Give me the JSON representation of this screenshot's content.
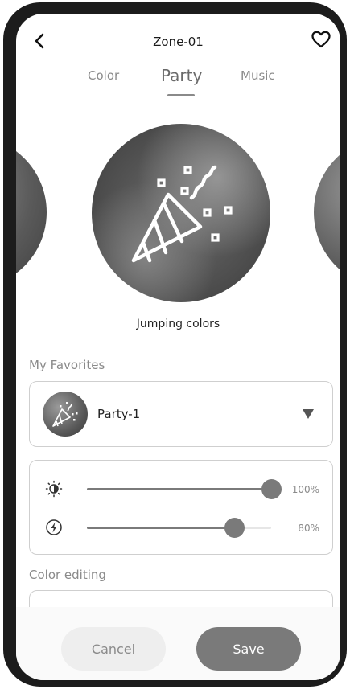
{
  "header": {
    "title": "Zone-01",
    "back_icon": "chevron-left-icon",
    "favorite_icon": "heart-outline-icon"
  },
  "tabs": [
    {
      "label": "Color",
      "active": false
    },
    {
      "label": "Party",
      "active": true
    },
    {
      "label": "Music",
      "active": false
    }
  ],
  "carousel": {
    "selected_effect": "Jumping colors",
    "icon": "party-popper-icon"
  },
  "favorites": {
    "label": "My Favorites",
    "selected": "Party-1",
    "thumb_icon": "party-popper-icon",
    "arrow_icon": "triangle-down-icon"
  },
  "sliders": [
    {
      "name": "brightness",
      "icon": "brightness-icon",
      "value": 100,
      "value_text": "100%"
    },
    {
      "name": "speed",
      "icon": "lightning-icon",
      "value": 80,
      "value_text": "80%"
    }
  ],
  "color_editing": {
    "label": "Color editing"
  },
  "actions": {
    "cancel_label": "Cancel",
    "save_label": "Save"
  },
  "colors": {
    "accent": "#7a7a7a",
    "text": "#222222",
    "muted": "#8a8a8a"
  }
}
